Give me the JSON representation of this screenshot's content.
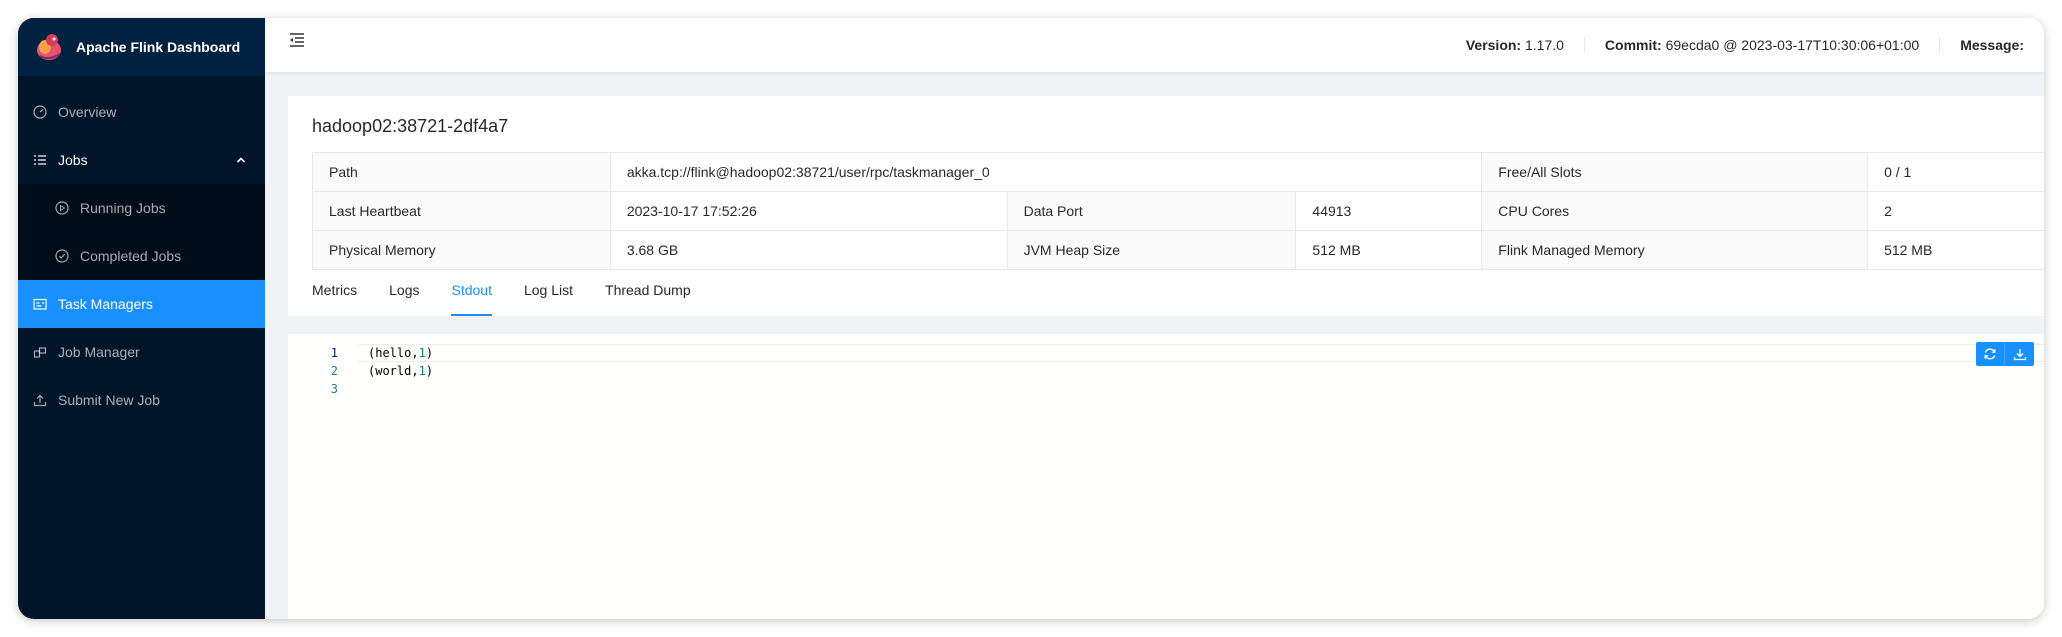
{
  "app": {
    "title": "Apache Flink Dashboard"
  },
  "sidebar": {
    "items": [
      {
        "label": "Overview",
        "icon": "dashboard-icon"
      },
      {
        "label": "Jobs",
        "icon": "bars-icon"
      },
      {
        "label": "Running Jobs",
        "icon": "play-circle-icon"
      },
      {
        "label": "Completed Jobs",
        "icon": "check-circle-icon"
      },
      {
        "label": "Task Managers",
        "icon": "schedule-icon"
      },
      {
        "label": "Job Manager",
        "icon": "build-icon"
      },
      {
        "label": "Submit New Job",
        "icon": "upload-icon"
      }
    ],
    "selected": "Task Managers"
  },
  "header": {
    "version_label": "Version:",
    "version": "1.17.0",
    "commit_label": "Commit:",
    "commit": "69ecda0 @ 2023-03-17T10:30:06+01:00",
    "message_label": "Message:"
  },
  "taskmanager": {
    "title": "hadoop02:38721-2df4a7",
    "rows": {
      "path_label": "Path",
      "path": "akka.tcp://flink@hadoop02:38721/user/rpc/taskmanager_0",
      "slots_label": "Free/All Slots",
      "slots": "0 / 1",
      "heartbeat_label": "Last Heartbeat",
      "heartbeat": "2023-10-17 17:52:26",
      "dataport_label": "Data Port",
      "dataport": "44913",
      "cpu_label": "CPU Cores",
      "cpu": "2",
      "physmem_label": "Physical Memory",
      "physmem": "3.68 GB",
      "heap_label": "JVM Heap Size",
      "heap": "512 MB",
      "managed_label": "Flink Managed Memory",
      "managed": "512 MB"
    }
  },
  "tabs": [
    {
      "label": "Metrics"
    },
    {
      "label": "Logs"
    },
    {
      "label": "Stdout"
    },
    {
      "label": "Log List"
    },
    {
      "label": "Thread Dump"
    }
  ],
  "active_tab": "Stdout",
  "editor": {
    "lines": [
      {
        "n": "1",
        "pre": "(hello,",
        "num": "1",
        "post": ")"
      },
      {
        "n": "2",
        "pre": "(world,",
        "num": "1",
        "post": ")"
      },
      {
        "n": "3",
        "pre": "",
        "num": "",
        "post": ""
      }
    ]
  },
  "colors": {
    "sider": "#001529",
    "accent": "#1890ff"
  }
}
